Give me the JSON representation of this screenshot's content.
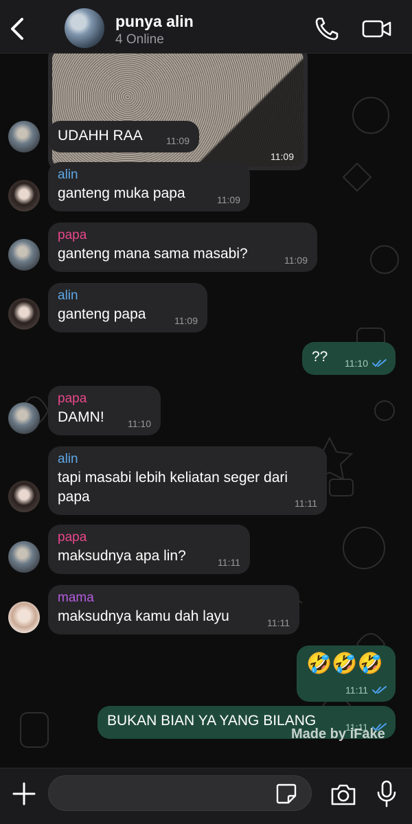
{
  "header": {
    "title": "punya alin",
    "subtitle": "4 Online"
  },
  "image_message": {
    "time": "11:09"
  },
  "messages": [
    {
      "sender": "",
      "text": "UDAHH RAA",
      "time": "11:09",
      "direction": "in"
    },
    {
      "sender": "alin",
      "text": "ganteng muka papa",
      "time": "11:09",
      "direction": "in"
    },
    {
      "sender": "papa",
      "text": "ganteng mana sama masabi?",
      "time": "11:09",
      "direction": "in"
    },
    {
      "sender": "alin",
      "text": "ganteng papa",
      "time": "11:09",
      "direction": "in"
    },
    {
      "sender": "",
      "text": "??",
      "time": "11:10",
      "direction": "out"
    },
    {
      "sender": "papa",
      "text": "DAMN!",
      "time": "11:10",
      "direction": "in"
    },
    {
      "sender": "alin",
      "text": "tapi masabi lebih keliatan seger dari papa",
      "time": "11:11",
      "direction": "in"
    },
    {
      "sender": "papa",
      "text": "maksudnya apa lin?",
      "time": "11:11",
      "direction": "in"
    },
    {
      "sender": "mama",
      "text": "maksudnya kamu dah layu",
      "time": "11:11",
      "direction": "in"
    },
    {
      "sender": "",
      "text": "🤣🤣🤣",
      "time": "11:11",
      "direction": "out"
    },
    {
      "sender": "",
      "text": "BUKAN BIAN YA YANG BILANG",
      "time": "11:11",
      "direction": "out"
    }
  ],
  "watermark": "Made by iFake",
  "composer": {
    "value": "",
    "placeholder": ""
  },
  "colors": {
    "incoming_bubble": "#262628",
    "outgoing_bubble": "#1f4a3b",
    "alin": "#5fa8e8",
    "papa": "#e8478c",
    "mama": "#b45de0",
    "read_ticks": "#53a6ff"
  },
  "icons": [
    "back-chevron-icon",
    "phone-icon",
    "video-call-icon",
    "plus-icon",
    "sticker-icon",
    "camera-icon",
    "microphone-icon",
    "double-check-icon"
  ]
}
